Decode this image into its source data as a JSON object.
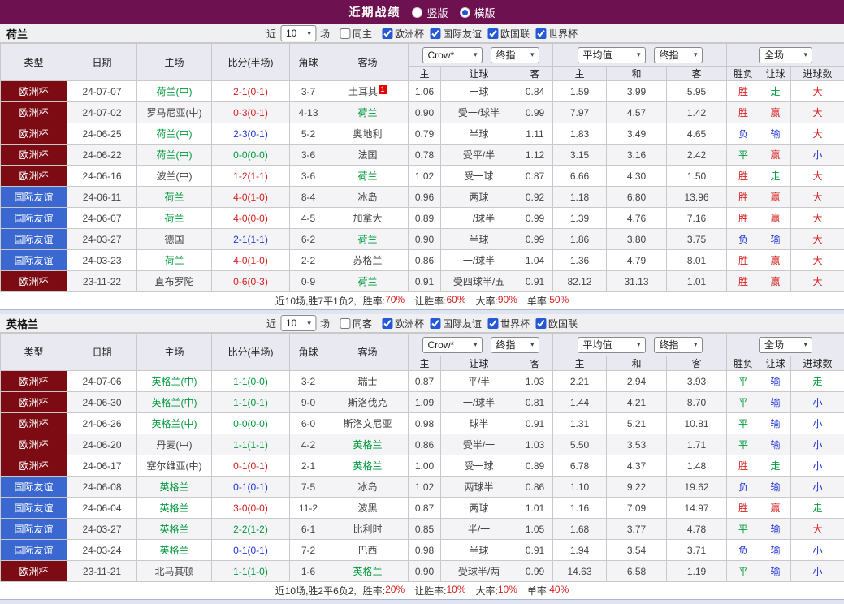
{
  "colors": {
    "topbar_bg": "#6e1150",
    "euro_tag_bg": "#7d0b14",
    "friendly_tag_bg": "#3a68d0",
    "win_red": "#d62020",
    "draw_green": "#009a3c",
    "loss_blue": "#2337d6",
    "focal_team_green": "#009a3c",
    "checkbox_blue": "#2458d6"
  },
  "topbar": {
    "title": "近期战绩",
    "options": [
      {
        "label": "竖版",
        "selected": false
      },
      {
        "label": "横版",
        "selected": true
      }
    ]
  },
  "table": {
    "cols": [
      "类型",
      "日期",
      "主场",
      "比分(半场)",
      "角球",
      "客场"
    ],
    "sub": [
      "主",
      "让球",
      "客",
      "主",
      "和",
      "客",
      "胜负",
      "让球",
      "进球数"
    ],
    "controls": {
      "odds_source": "Crow*",
      "final_label": "终指",
      "average": "平均值",
      "scope": "全场"
    }
  },
  "sections": [
    {
      "team": "荷兰",
      "filter": {
        "near_label": "近",
        "count": "10",
        "matches_label": "场",
        "same_label": "同主",
        "same_checked": false,
        "leagues": [
          "欧洲杯",
          "国际友谊",
          "欧国联",
          "世界杯"
        ]
      },
      "rows": [
        {
          "comp": "欧洲杯",
          "comp_type": "euro",
          "date": "24-07-07",
          "home": "荷兰(中)",
          "home_focal": true,
          "score": "2-1(0-1)",
          "score_res": "w",
          "corners": "3-7",
          "away": "土耳其",
          "away_focal": false,
          "away_badge": "1",
          "o1": "1.06",
          "handicap": "一球",
          "o2": "0.84",
          "avg_h": "1.59",
          "avg_d": "3.99",
          "avg_a": "5.95",
          "res": "胜",
          "res_c": "r",
          "cover": "走",
          "cover_c": "g",
          "goals": "大",
          "goals_c": "r"
        },
        {
          "comp": "欧洲杯",
          "comp_type": "euro",
          "date": "24-07-02",
          "home": "罗马尼亚(中)",
          "home_focal": false,
          "score": "0-3(0-1)",
          "score_res": "w",
          "corners": "4-13",
          "away": "荷兰",
          "away_focal": true,
          "o1": "0.90",
          "handicap": "受一/球半",
          "o2": "0.99",
          "avg_h": "7.97",
          "avg_d": "4.57",
          "avg_a": "1.42",
          "res": "胜",
          "res_c": "r",
          "cover": "赢",
          "cover_c": "r",
          "goals": "大",
          "goals_c": "r"
        },
        {
          "comp": "欧洲杯",
          "comp_type": "euro",
          "date": "24-06-25",
          "home": "荷兰(中)",
          "home_focal": true,
          "score": "2-3(0-1)",
          "score_res": "l",
          "corners": "5-2",
          "away": "奥地利",
          "away_focal": false,
          "o1": "0.79",
          "handicap": "半球",
          "o2": "1.11",
          "avg_h": "1.83",
          "avg_d": "3.49",
          "avg_a": "4.65",
          "res": "负",
          "res_c": "b",
          "cover": "输",
          "cover_c": "b",
          "goals": "大",
          "goals_c": "r"
        },
        {
          "comp": "欧洲杯",
          "comp_type": "euro",
          "date": "24-06-22",
          "home": "荷兰(中)",
          "home_focal": true,
          "score": "0-0(0-0)",
          "score_res": "d",
          "corners": "3-6",
          "away": "法国",
          "away_focal": false,
          "o1": "0.78",
          "handicap": "受平/半",
          "o2": "1.12",
          "avg_h": "3.15",
          "avg_d": "3.16",
          "avg_a": "2.42",
          "res": "平",
          "res_c": "g",
          "cover": "赢",
          "cover_c": "r",
          "goals": "小",
          "goals_c": "b"
        },
        {
          "comp": "欧洲杯",
          "comp_type": "euro",
          "date": "24-06-16",
          "home": "波兰(中)",
          "home_focal": false,
          "score": "1-2(1-1)",
          "score_res": "w",
          "corners": "3-6",
          "away": "荷兰",
          "away_focal": true,
          "o1": "1.02",
          "handicap": "受一球",
          "o2": "0.87",
          "avg_h": "6.66",
          "avg_d": "4.30",
          "avg_a": "1.50",
          "res": "胜",
          "res_c": "r",
          "cover": "走",
          "cover_c": "g",
          "goals": "大",
          "goals_c": "r"
        },
        {
          "comp": "国际友谊",
          "comp_type": "friendly",
          "date": "24-06-11",
          "home": "荷兰",
          "home_focal": true,
          "score": "4-0(1-0)",
          "score_res": "w",
          "corners": "8-4",
          "away": "冰岛",
          "away_focal": false,
          "o1": "0.96",
          "handicap": "两球",
          "o2": "0.92",
          "avg_h": "1.18",
          "avg_d": "6.80",
          "avg_a": "13.96",
          "res": "胜",
          "res_c": "r",
          "cover": "赢",
          "cover_c": "r",
          "goals": "大",
          "goals_c": "r"
        },
        {
          "comp": "国际友谊",
          "comp_type": "friendly",
          "date": "24-06-07",
          "home": "荷兰",
          "home_focal": true,
          "score": "4-0(0-0)",
          "score_res": "w",
          "corners": "4-5",
          "away": "加拿大",
          "away_focal": false,
          "o1": "0.89",
          "handicap": "一/球半",
          "o2": "0.99",
          "avg_h": "1.39",
          "avg_d": "4.76",
          "avg_a": "7.16",
          "res": "胜",
          "res_c": "r",
          "cover": "赢",
          "cover_c": "r",
          "goals": "大",
          "goals_c": "r"
        },
        {
          "comp": "国际友谊",
          "comp_type": "friendly",
          "date": "24-03-27",
          "home": "德国",
          "home_focal": false,
          "score": "2-1(1-1)",
          "score_res": "l",
          "corners": "6-2",
          "away": "荷兰",
          "away_focal": true,
          "o1": "0.90",
          "handicap": "半球",
          "o2": "0.99",
          "avg_h": "1.86",
          "avg_d": "3.80",
          "avg_a": "3.75",
          "res": "负",
          "res_c": "b",
          "cover": "输",
          "cover_c": "b",
          "goals": "大",
          "goals_c": "r"
        },
        {
          "comp": "国际友谊",
          "comp_type": "friendly",
          "date": "24-03-23",
          "home": "荷兰",
          "home_focal": true,
          "score": "4-0(1-0)",
          "score_res": "w",
          "corners": "2-2",
          "away": "苏格兰",
          "away_focal": false,
          "o1": "0.86",
          "handicap": "一/球半",
          "o2": "1.04",
          "avg_h": "1.36",
          "avg_d": "4.79",
          "avg_a": "8.01",
          "res": "胜",
          "res_c": "r",
          "cover": "赢",
          "cover_c": "r",
          "goals": "大",
          "goals_c": "r"
        },
        {
          "comp": "欧洲杯",
          "comp_type": "euro",
          "date": "23-11-22",
          "home": "直布罗陀",
          "home_focal": false,
          "score": "0-6(0-3)",
          "score_res": "w",
          "corners": "0-9",
          "away": "荷兰",
          "away_focal": true,
          "o1": "0.91",
          "handicap": "受四球半/五",
          "o2": "0.91",
          "avg_h": "82.12",
          "avg_d": "31.13",
          "avg_a": "1.01",
          "res": "胜",
          "res_c": "r",
          "cover": "赢",
          "cover_c": "r",
          "goals": "大",
          "goals_c": "r"
        }
      ],
      "summary": {
        "record": "近10场,胜7平1负2,",
        "stats": [
          {
            "label": "胜率:",
            "value": "70%"
          },
          {
            "label": "让胜率:",
            "value": "60%"
          },
          {
            "label": "大率:",
            "value": "90%"
          },
          {
            "label": "单率:",
            "value": "50%"
          }
        ]
      }
    },
    {
      "team": "英格兰",
      "filter": {
        "near_label": "近",
        "count": "10",
        "matches_label": "场",
        "same_label": "同客",
        "same_checked": false,
        "leagues": [
          "欧洲杯",
          "国际友谊",
          "世界杯",
          "欧国联"
        ]
      },
      "rows": [
        {
          "comp": "欧洲杯",
          "comp_type": "euro",
          "date": "24-07-06",
          "home": "英格兰(中)",
          "home_focal": true,
          "score": "1-1(0-0)",
          "score_res": "d",
          "corners": "3-2",
          "away": "瑞士",
          "away_focal": false,
          "o1": "0.87",
          "handicap": "平/半",
          "o2": "1.03",
          "avg_h": "2.21",
          "avg_d": "2.94",
          "avg_a": "3.93",
          "res": "平",
          "res_c": "g",
          "cover": "输",
          "cover_c": "b",
          "goals": "走",
          "goals_c": "g"
        },
        {
          "comp": "欧洲杯",
          "comp_type": "euro",
          "date": "24-06-30",
          "home": "英格兰(中)",
          "home_focal": true,
          "score": "1-1(0-1)",
          "score_res": "d",
          "corners": "9-0",
          "away": "斯洛伐克",
          "away_focal": false,
          "o1": "1.09",
          "handicap": "一/球半",
          "o2": "0.81",
          "avg_h": "1.44",
          "avg_d": "4.21",
          "avg_a": "8.70",
          "res": "平",
          "res_c": "g",
          "cover": "输",
          "cover_c": "b",
          "goals": "小",
          "goals_c": "b"
        },
        {
          "comp": "欧洲杯",
          "comp_type": "euro",
          "date": "24-06-26",
          "home": "英格兰(中)",
          "home_focal": true,
          "score": "0-0(0-0)",
          "score_res": "d",
          "corners": "6-0",
          "away": "斯洛文尼亚",
          "away_focal": false,
          "o1": "0.98",
          "handicap": "球半",
          "o2": "0.91",
          "avg_h": "1.31",
          "avg_d": "5.21",
          "avg_a": "10.81",
          "res": "平",
          "res_c": "g",
          "cover": "输",
          "cover_c": "b",
          "goals": "小",
          "goals_c": "b"
        },
        {
          "comp": "欧洲杯",
          "comp_type": "euro",
          "date": "24-06-20",
          "home": "丹麦(中)",
          "home_focal": false,
          "score": "1-1(1-1)",
          "score_res": "d",
          "corners": "4-2",
          "away": "英格兰",
          "away_focal": true,
          "o1": "0.86",
          "handicap": "受半/一",
          "o2": "1.03",
          "avg_h": "5.50",
          "avg_d": "3.53",
          "avg_a": "1.71",
          "res": "平",
          "res_c": "g",
          "cover": "输",
          "cover_c": "b",
          "goals": "小",
          "goals_c": "b"
        },
        {
          "comp": "欧洲杯",
          "comp_type": "euro",
          "date": "24-06-17",
          "home": "塞尔维亚(中)",
          "home_focal": false,
          "score": "0-1(0-1)",
          "score_res": "w",
          "corners": "2-1",
          "away": "英格兰",
          "away_focal": true,
          "o1": "1.00",
          "handicap": "受一球",
          "o2": "0.89",
          "avg_h": "6.78",
          "avg_d": "4.37",
          "avg_a": "1.48",
          "res": "胜",
          "res_c": "r",
          "cover": "走",
          "cover_c": "g",
          "goals": "小",
          "goals_c": "b"
        },
        {
          "comp": "国际友谊",
          "comp_type": "friendly",
          "date": "24-06-08",
          "home": "英格兰",
          "home_focal": true,
          "score": "0-1(0-1)",
          "score_res": "l",
          "corners": "7-5",
          "away": "冰岛",
          "away_focal": false,
          "o1": "1.02",
          "handicap": "两球半",
          "o2": "0.86",
          "avg_h": "1.10",
          "avg_d": "9.22",
          "avg_a": "19.62",
          "res": "负",
          "res_c": "b",
          "cover": "输",
          "cover_c": "b",
          "goals": "小",
          "goals_c": "b"
        },
        {
          "comp": "国际友谊",
          "comp_type": "friendly",
          "date": "24-06-04",
          "home": "英格兰",
          "home_focal": true,
          "score": "3-0(0-0)",
          "score_res": "w",
          "corners": "11-2",
          "away": "波黑",
          "away_focal": false,
          "o1": "0.87",
          "handicap": "两球",
          "o2": "1.01",
          "avg_h": "1.16",
          "avg_d": "7.09",
          "avg_a": "14.97",
          "res": "胜",
          "res_c": "r",
          "cover": "赢",
          "cover_c": "r",
          "goals": "走",
          "goals_c": "g"
        },
        {
          "comp": "国际友谊",
          "comp_type": "friendly",
          "date": "24-03-27",
          "home": "英格兰",
          "home_focal": true,
          "score": "2-2(1-2)",
          "score_res": "d",
          "corners": "6-1",
          "away": "比利时",
          "away_focal": false,
          "o1": "0.85",
          "handicap": "半/一",
          "o2": "1.05",
          "avg_h": "1.68",
          "avg_d": "3.77",
          "avg_a": "4.78",
          "res": "平",
          "res_c": "g",
          "cover": "输",
          "cover_c": "b",
          "goals": "大",
          "goals_c": "r"
        },
        {
          "comp": "国际友谊",
          "comp_type": "friendly",
          "date": "24-03-24",
          "home": "英格兰",
          "home_focal": true,
          "score": "0-1(0-1)",
          "score_res": "l",
          "corners": "7-2",
          "away": "巴西",
          "away_focal": false,
          "o1": "0.98",
          "handicap": "半球",
          "o2": "0.91",
          "avg_h": "1.94",
          "avg_d": "3.54",
          "avg_a": "3.71",
          "res": "负",
          "res_c": "b",
          "cover": "输",
          "cover_c": "b",
          "goals": "小",
          "goals_c": "b"
        },
        {
          "comp": "欧洲杯",
          "comp_type": "euro",
          "date": "23-11-21",
          "home": "北马其顿",
          "home_focal": false,
          "score": "1-1(1-0)",
          "score_res": "d",
          "corners": "1-6",
          "away": "英格兰",
          "away_focal": true,
          "o1": "0.90",
          "handicap": "受球半/两",
          "o2": "0.99",
          "avg_h": "14.63",
          "avg_d": "6.58",
          "avg_a": "1.19",
          "res": "平",
          "res_c": "g",
          "cover": "输",
          "cover_c": "b",
          "goals": "小",
          "goals_c": "b"
        }
      ],
      "summary": {
        "record": "近10场,胜2平6负2,",
        "stats": [
          {
            "label": "胜率:",
            "value": "20%"
          },
          {
            "label": "让胜率:",
            "value": "10%"
          },
          {
            "label": "大率:",
            "value": "10%"
          },
          {
            "label": "单率:",
            "value": "40%"
          }
        ]
      }
    }
  ]
}
